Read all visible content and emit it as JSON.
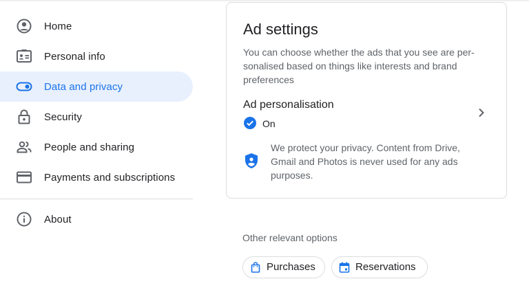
{
  "sidebar": {
    "items": [
      {
        "label": "Home",
        "icon": "account-circle-icon",
        "active": false
      },
      {
        "label": "Personal info",
        "icon": "id-card-icon",
        "active": false
      },
      {
        "label": "Data and privacy",
        "icon": "toggle-icon",
        "active": true
      },
      {
        "label": "Security",
        "icon": "lock-icon",
        "active": false
      },
      {
        "label": "People and sharing",
        "icon": "people-icon",
        "active": false
      },
      {
        "label": "Payments and subscriptions",
        "icon": "credit-card-icon",
        "active": false
      }
    ],
    "about": {
      "label": "About",
      "icon": "info-icon"
    }
  },
  "ad_settings": {
    "title": "Ad settings",
    "description": "You can choose whether the ads that you see are per-sonalised based on things like interests and brand preferences",
    "setting_label": "Ad personalisation",
    "status": "On",
    "privacy_note": "We protect your privacy. Content from Drive, Gmail and Photos is never used for any ads purposes."
  },
  "other_options": {
    "heading": "Other relevant options",
    "chips": [
      {
        "label": "Purchases",
        "icon": "shopping-bag-icon"
      },
      {
        "label": "Reservations",
        "icon": "calendar-icon"
      }
    ]
  },
  "colors": {
    "accent": "#1a73e8",
    "active_bg": "#e8f0fe",
    "border": "#dadce0",
    "secondary_text": "#5f6368"
  }
}
